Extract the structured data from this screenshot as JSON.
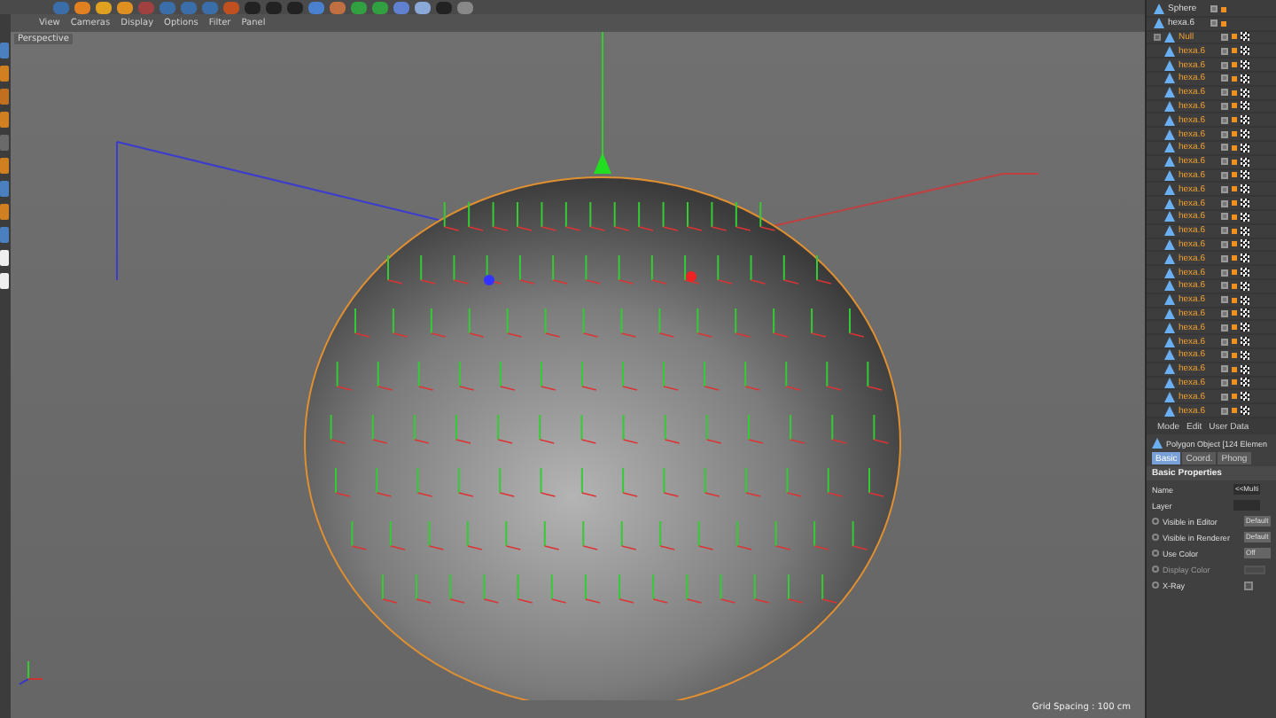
{
  "viewport_menu": [
    "View",
    "Cameras",
    "Display",
    "Options",
    "Filter",
    "Panel"
  ],
  "viewport": {
    "camera_label": "Perspective",
    "grid_spacing": "Grid Spacing : 100 cm"
  },
  "object_manager": {
    "objects": [
      {
        "name": "Sphere",
        "kind": "object"
      },
      {
        "name": "hexa.6",
        "kind": "object"
      },
      {
        "name": "Null",
        "kind": "null",
        "expanded": true,
        "children": [
          {
            "name": "hexa.6"
          },
          {
            "name": "hexa.6"
          },
          {
            "name": "hexa.6"
          },
          {
            "name": "hexa.6"
          },
          {
            "name": "hexa.6"
          },
          {
            "name": "hexa.6"
          },
          {
            "name": "hexa.6"
          },
          {
            "name": "hexa.6"
          },
          {
            "name": "hexa.6"
          },
          {
            "name": "hexa.6"
          },
          {
            "name": "hexa.6"
          },
          {
            "name": "hexa.6"
          },
          {
            "name": "hexa.6"
          },
          {
            "name": "hexa.6"
          },
          {
            "name": "hexa.6"
          },
          {
            "name": "hexa.6"
          },
          {
            "name": "hexa.6"
          },
          {
            "name": "hexa.6"
          },
          {
            "name": "hexa.6"
          },
          {
            "name": "hexa.6"
          },
          {
            "name": "hexa.6"
          },
          {
            "name": "hexa.6"
          },
          {
            "name": "hexa.6"
          },
          {
            "name": "hexa.6"
          },
          {
            "name": "hexa.6"
          },
          {
            "name": "hexa.6"
          },
          {
            "name": "hexa.6"
          }
        ]
      }
    ]
  },
  "attributes": {
    "menu": [
      "Mode",
      "Edit",
      "User Data"
    ],
    "object_title": "Polygon Object [124 Elemen",
    "tabs": [
      {
        "label": "Basic",
        "selected": true
      },
      {
        "label": "Coord.",
        "selected": false
      },
      {
        "label": "Phong",
        "selected": false
      }
    ],
    "section": "Basic Properties",
    "fields": [
      {
        "label": "Name",
        "kind": "text",
        "value": "<<Multi"
      },
      {
        "label": "Layer",
        "kind": "text"
      },
      {
        "label": "Visible in Editor",
        "kind": "dropdown",
        "value": "Default"
      },
      {
        "label": "Visible in Renderer",
        "kind": "dropdown",
        "value": "Default"
      },
      {
        "label": "Use Color",
        "kind": "dropdown",
        "value": "Off"
      },
      {
        "label": "Display Color",
        "kind": "color",
        "disabled": true
      },
      {
        "label": "X-Ray",
        "kind": "checkbox",
        "checked": false
      }
    ]
  }
}
